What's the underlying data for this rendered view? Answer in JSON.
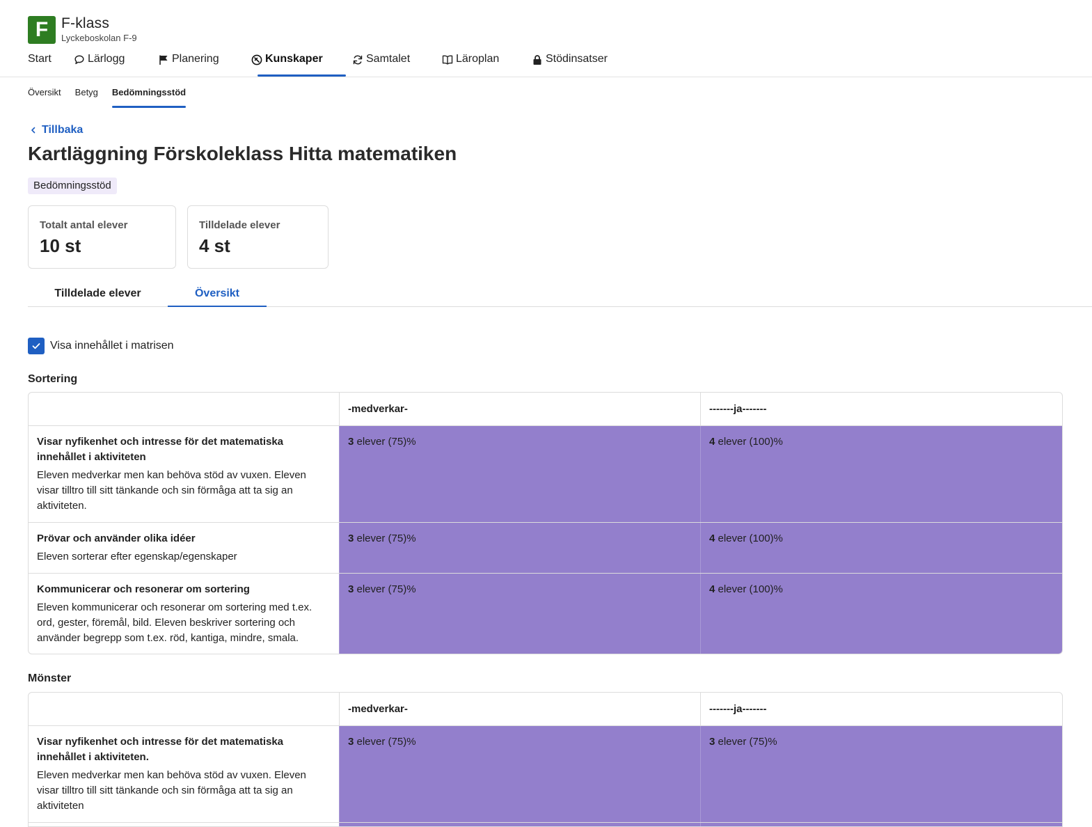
{
  "header": {
    "logo_letter": "F",
    "class_name": "F-klass",
    "school": "Lyckeboskolan F-9"
  },
  "main_nav": {
    "items": [
      {
        "label": "Start",
        "icon": "none"
      },
      {
        "label": "Lärlogg",
        "icon": "speech-bubble-icon"
      },
      {
        "label": "Planering",
        "icon": "flag-icon"
      },
      {
        "label": "Kunskaper",
        "icon": "compass-icon",
        "active": true
      },
      {
        "label": "Samtalet",
        "icon": "refresh-icon"
      },
      {
        "label": "Läroplan",
        "icon": "book-icon"
      },
      {
        "label": "Stödinsatser",
        "icon": "lock-icon"
      }
    ]
  },
  "sub_nav": {
    "items": [
      {
        "label": "Översikt"
      },
      {
        "label": "Betyg"
      },
      {
        "label": "Bedömningsstöd",
        "active": true
      }
    ]
  },
  "back_label": "Tillbaka",
  "page_title": "Kartläggning Förskoleklass Hitta matematiken",
  "tag": "Bedömningsstöd",
  "stats": [
    {
      "label": "Totalt antal elever",
      "value": "10 st"
    },
    {
      "label": "Tilldelade elever",
      "value": "4 st"
    }
  ],
  "content_tabs": [
    {
      "label": "Tilldelade elever"
    },
    {
      "label": "Översikt",
      "active": true
    }
  ],
  "show_content_checkbox": {
    "label": "Visa innehållet i matrisen",
    "checked": true
  },
  "colors": {
    "accent": "#1f5fc2",
    "logo": "#2e7d22",
    "matrix_fill": "#937fcc"
  },
  "sections": [
    {
      "title": "Sortering",
      "columns": [
        "-medverkar-",
        "-------ja-------"
      ],
      "rows": [
        {
          "title": "Visar nyfikenhet och intresse för det matematiska innehållet i aktiviteten",
          "desc": "Eleven medverkar men kan behöva stöd av vuxen. Eleven visar tilltro till sitt tänkande och sin förmåga att ta sig an aktiviteten.",
          "cells": [
            {
              "count": "3",
              "text": " elever (75)%"
            },
            {
              "count": "4",
              "text": " elever (100)%"
            }
          ]
        },
        {
          "title": "Prövar och använder olika idéer",
          "desc": "Eleven sorterar efter egenskap/egenskaper",
          "cells": [
            {
              "count": "3",
              "text": " elever (75)%"
            },
            {
              "count": "4",
              "text": " elever (100)%"
            }
          ]
        },
        {
          "title": "Kommunicerar och resonerar om sortering",
          "desc": "Eleven kommunicerar och resonerar om sortering med t.ex. ord, gester, föremål, bild. Eleven beskriver sortering och använder begrepp som t.ex. röd, kantiga, mindre, smala.",
          "cells": [
            {
              "count": "3",
              "text": " elever (75)%"
            },
            {
              "count": "4",
              "text": " elever (100)%"
            }
          ]
        }
      ]
    },
    {
      "title": "Mönster",
      "columns": [
        "-medverkar-",
        "-------ja-------"
      ],
      "rows": [
        {
          "title": "Visar nyfikenhet och intresse för det matematiska innehållet i aktiviteten.",
          "desc": "Eleven medverkar men kan behöva stöd av vuxen. Eleven visar tilltro till sitt tänkande och sin förmåga att ta sig an aktiviteten",
          "cells": [
            {
              "count": "3",
              "text": " elever (75)%"
            },
            {
              "count": "3",
              "text": " elever (75)%"
            }
          ]
        }
      ]
    }
  ]
}
